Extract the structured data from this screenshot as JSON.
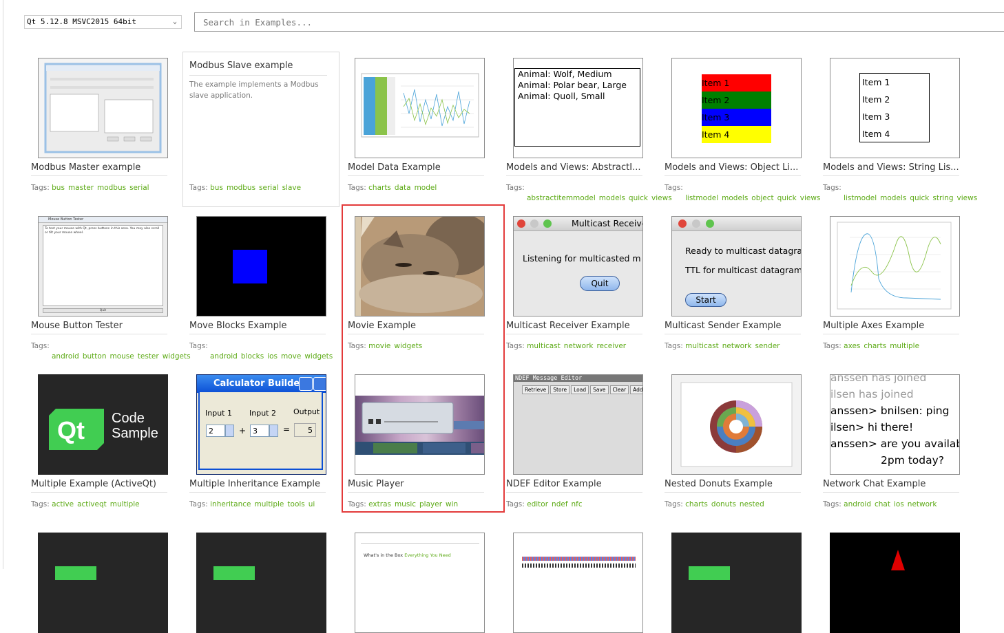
{
  "toolbar": {
    "kit_value": "Qt 5.12.8 MSVC2015 64bit",
    "search_placeholder": "Search in Examples..."
  },
  "tags_label": "Tags:",
  "examples": [
    {
      "title": "Modbus Master example",
      "tags": [
        "bus",
        "master",
        "modbus",
        "serial"
      ]
    },
    {
      "title": "Modbus Slave example",
      "description": "The example implements a Modbus slave application.",
      "tags": [
        "bus",
        "modbus",
        "serial",
        "slave"
      ]
    },
    {
      "title": "Model Data Example",
      "tags": [
        "charts",
        "data",
        "model"
      ]
    },
    {
      "title": "Models and Views: AbstractI...",
      "tags": [
        "abstractitemmodel",
        "models",
        "quick",
        "views"
      ]
    },
    {
      "title": "Models and Views: Object Li...",
      "tags": [
        "listmodel",
        "models",
        "object",
        "quick",
        "views"
      ]
    },
    {
      "title": "Models and Views: String Lis...",
      "tags": [
        "listmodel",
        "models",
        "quick",
        "string",
        "views"
      ]
    },
    {
      "title": "Mouse Button Tester",
      "tags": [
        "android",
        "button",
        "mouse",
        "tester",
        "widgets"
      ]
    },
    {
      "title": "Move Blocks Example",
      "tags": [
        "android",
        "blocks",
        "ios",
        "move",
        "widgets"
      ]
    },
    {
      "title": "Movie Example",
      "tags": [
        "movie",
        "widgets"
      ]
    },
    {
      "title": "Multicast Receiver Example",
      "tags": [
        "multicast",
        "network",
        "receiver"
      ]
    },
    {
      "title": "Multicast Sender Example",
      "tags": [
        "multicast",
        "network",
        "sender"
      ]
    },
    {
      "title": "Multiple Axes Example",
      "tags": [
        "axes",
        "charts",
        "multiple"
      ]
    },
    {
      "title": "Multiple Example (ActiveQt)",
      "tags": [
        "active",
        "activeqt",
        "multiple"
      ]
    },
    {
      "title": "Multiple Inheritance Example",
      "tags": [
        "inheritance",
        "multiple",
        "tools",
        "ui"
      ]
    },
    {
      "title": "Music Player",
      "tags": [
        "extras",
        "music",
        "player",
        "win"
      ]
    },
    {
      "title": "NDEF Editor Example",
      "tags": [
        "editor",
        "ndef",
        "nfc"
      ]
    },
    {
      "title": "Nested Donuts Example",
      "tags": [
        "charts",
        "donuts",
        "nested"
      ]
    },
    {
      "title": "Network Chat Example",
      "tags": [
        "android",
        "chat",
        "ios",
        "network"
      ]
    }
  ],
  "thumbs": {
    "animals": [
      "Animal: Wolf, Medium",
      "Animal: Polar bear, Large",
      "Animal: Quoll, Small"
    ],
    "object_items": [
      "Item 1",
      "Item 2",
      "Item 3",
      "Item 4"
    ],
    "string_items": [
      "Item 1",
      "Item 2",
      "Item 3",
      "Item 4"
    ],
    "receiver": {
      "title": "Multicast Receive",
      "text": "Listening for multicasted m",
      "button": "Quit"
    },
    "sender": {
      "line1": "Ready to multicast datagra",
      "line2": "TTL for multicast datagram",
      "button": "Start"
    },
    "code_sample": {
      "line1": "Code",
      "line2": "Sample"
    },
    "calculator": {
      "title": "Calculator Builder",
      "input1_label": "Input 1",
      "input2_label": "Input 2",
      "output_label": "Output",
      "input1": "2",
      "input2": "3",
      "output": "5",
      "plus": "+",
      "equals": "="
    },
    "ndef": {
      "title": "NDEF Message Editor",
      "buttons": [
        "Retrieve",
        "Store",
        "Load",
        "Save",
        "Clear",
        "Add"
      ]
    },
    "chat": [
      "anssen has joined",
      "ilsen has joined",
      "anssen> bnilsen: ping",
      "ilsen> hi there!",
      "anssen> are you availab",
      "2pm today?"
    ],
    "mouse_tester": {
      "title": "Mouse Button Tester",
      "text": "To test your mouse with Qt, press buttons in this area. You may also scroll or tilt your mouse wheel.",
      "button": "Quit"
    },
    "box_text": {
      "prefix": "What's in the Box",
      "highlight": "Everything You Need"
    }
  },
  "colors": {
    "tag_green": "#5caa15",
    "highlight_red": "#e33a3a",
    "qt_green": "#41cd52"
  }
}
